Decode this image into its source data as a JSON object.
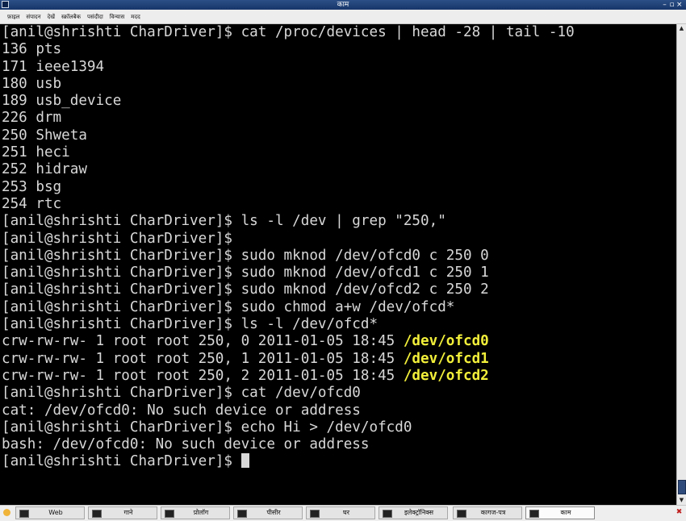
{
  "window": {
    "title": "काम",
    "controls": [
      "–",
      "▫",
      "×"
    ]
  },
  "menu": {
    "items": [
      "फ़ाइल",
      "संपादन",
      "देखें",
      "स्क्रॉलबैक",
      "पसंदीदा",
      "विन्यास",
      "मदद"
    ]
  },
  "terminal": {
    "prompt": "[anil@shrishti CharDriver]$ ",
    "lines": [
      {
        "text": "[anil@shrishti CharDriver]$ cat /proc/devices | head -28 | tail -10"
      },
      {
        "text": "136 pts"
      },
      {
        "text": "171 ieee1394"
      },
      {
        "text": "180 usb"
      },
      {
        "text": "189 usb_device"
      },
      {
        "text": "226 drm"
      },
      {
        "text": "250 Shweta"
      },
      {
        "text": "251 heci"
      },
      {
        "text": "252 hidraw"
      },
      {
        "text": "253 bsg"
      },
      {
        "text": "254 rtc"
      },
      {
        "text": "[anil@shrishti CharDriver]$ ls -l /dev | grep \"250,\""
      },
      {
        "text": "[anil@shrishti CharDriver]$"
      },
      {
        "text": "[anil@shrishti CharDriver]$ sudo mknod /dev/ofcd0 c 250 0"
      },
      {
        "text": "[anil@shrishti CharDriver]$ sudo mknod /dev/ofcd1 c 250 1"
      },
      {
        "text": "[anil@shrishti CharDriver]$ sudo mknod /dev/ofcd2 c 250 2"
      },
      {
        "text": "[anil@shrishti CharDriver]$ sudo chmod a+w /dev/ofcd*"
      },
      {
        "text": "[anil@shrishti CharDriver]$ ls -l /dev/ofcd*"
      },
      {
        "text": "crw-rw-rw- 1 root root 250, 0 2011-01-05 18:45 ",
        "hl": "/dev/ofcd0"
      },
      {
        "text": "crw-rw-rw- 1 root root 250, 1 2011-01-05 18:45 ",
        "hl": "/dev/ofcd1"
      },
      {
        "text": "crw-rw-rw- 1 root root 250, 2 2011-01-05 18:45 ",
        "hl": "/dev/ofcd2"
      },
      {
        "text": "[anil@shrishti CharDriver]$ cat /dev/ofcd0"
      },
      {
        "text": "cat: /dev/ofcd0: No such device or address"
      },
      {
        "text": "[anil@shrishti CharDriver]$ echo Hi > /dev/ofcd0"
      },
      {
        "text": "bash: /dev/ofcd0: No such device or address"
      },
      {
        "text": "[anil@shrishti CharDriver]$ ",
        "cursor": true
      }
    ],
    "colors": {
      "background": "#000000",
      "text": "#d8d8d8",
      "highlight": "#f2ef3a"
    }
  },
  "taskbar": {
    "tasks": [
      {
        "label": "Web",
        "active": false
      },
      {
        "label": "गाने",
        "active": false
      },
      {
        "label": "प्रोलॉग",
        "active": false
      },
      {
        "label": "पीसीर",
        "active": false
      },
      {
        "label": "घर",
        "active": false
      },
      {
        "label": "इलेक्ट्रॉनिक्स",
        "active": false
      },
      {
        "label": "कागज-पत्र",
        "active": false
      },
      {
        "label": "काम",
        "active": true
      }
    ]
  }
}
